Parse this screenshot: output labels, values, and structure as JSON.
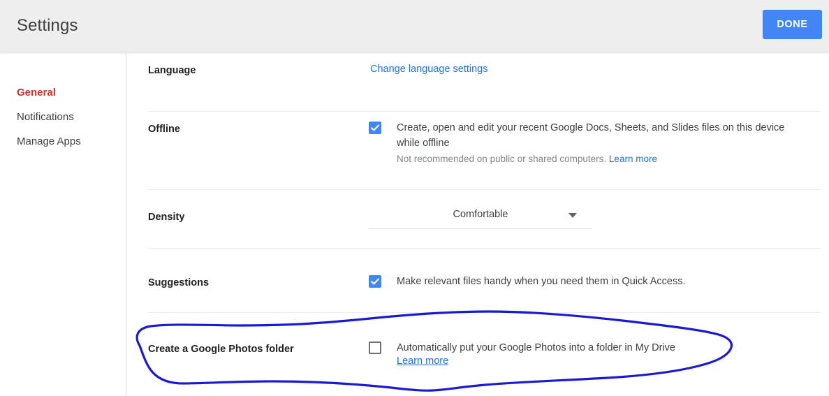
{
  "header": {
    "title": "Settings",
    "done_label": "DONE",
    "done_color": "#4285f4"
  },
  "sidebar": {
    "items": [
      {
        "label": "General",
        "active": true
      },
      {
        "label": "Notifications",
        "active": false
      },
      {
        "label": "Manage Apps",
        "active": false
      }
    ],
    "active_color": "#c5372c"
  },
  "settings_rows": [
    {
      "label": "Language",
      "link": "Change language settings"
    },
    {
      "label": "Offline",
      "checkbox_checked": true,
      "description": "Create, open and edit your recent Google Docs, Sheets, and Slides files on this device while offline",
      "sub_text": "Not recommended on public or shared computers.",
      "sub_link": "Learn more"
    },
    {
      "label": "Density",
      "dropdown_value": "Comfortable"
    },
    {
      "label": "Suggestions",
      "checkbox_checked": true,
      "description": "Make relevant files handy when you need them in Quick Access."
    },
    {
      "label": "Create a Google Photos folder",
      "checkbox_checked": false,
      "description": "Automatically put your Google Photos into a folder in My Drive",
      "sub_link": "Learn more"
    }
  ],
  "annotation": {
    "shape": "hand-drawn-ellipse",
    "color": "#1a19d8",
    "target_row_label": "Create a Google Photos folder"
  },
  "link_color": "#1a73e8"
}
